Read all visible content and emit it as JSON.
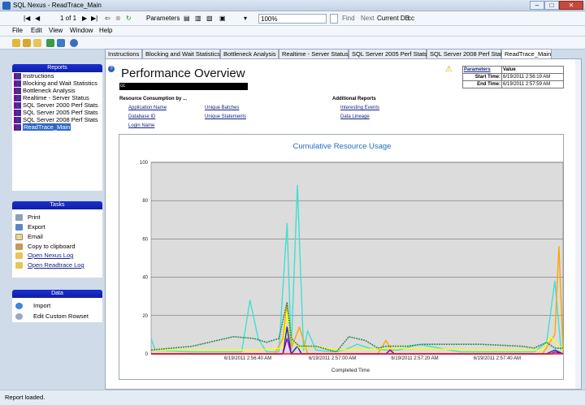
{
  "window": {
    "title": "SQL Nexus - ReadTrace_Main",
    "min": "–",
    "max": "□",
    "close": "✕"
  },
  "toolbar": {
    "page_info": "1 of 1",
    "parameters_label": "Parameters",
    "zoom": "100%",
    "find_label": "Find",
    "next_label": "Next",
    "current_db_label": "Current DB",
    "current_db_value": "cc"
  },
  "menu": [
    "File",
    "Edit",
    "View",
    "Window",
    "Help"
  ],
  "reports_panel": {
    "header": "Reports",
    "items": [
      "Instructions",
      "Blocking and Wait Statistics",
      "Bottleneck Analysis",
      "Realtime - Server Status",
      "SQL Server 2000 Perf Stats",
      "SQL Server 2005 Perf Stats",
      "SQL Server 2008 Perf Stats",
      "ReadTrace_Main"
    ],
    "selected": 7
  },
  "tasks_panel": {
    "header": "Tasks",
    "items": [
      "Print",
      "Export",
      "Email",
      "Copy to clipboard",
      "Open Nexus Log",
      "Open Readtrace Log"
    ]
  },
  "data_panel": {
    "header": "Data",
    "items": [
      "Import",
      "Edit Custom Rowset"
    ]
  },
  "tabs": [
    "Instructions",
    "Blocking and Wait Statistics",
    "Bottleneck Analysis",
    "Realtime - Server Status",
    "SQL Server 2005 Perf Stats",
    "SQL Server 2008 Perf Stats",
    "ReadTrace_Main"
  ],
  "active_tab": 6,
  "report": {
    "title": "Performance Overview",
    "server": "cc",
    "resource_heading": "Resource Consumption by ...",
    "resource_links_col1": [
      "Application Name",
      "Database ID",
      "Login Name"
    ],
    "resource_links_col2": [
      "Unique Batches",
      "Unique Statements"
    ],
    "additional_heading": "Additional Reports",
    "additional_links": [
      "Interesting Events",
      "Data Lineage"
    ],
    "params_table": {
      "headers": [
        "Parameters",
        "Value"
      ],
      "rows": [
        [
          "Start Time:",
          "6/19/2011 2:56:19 AM"
        ],
        [
          "End Time:",
          "6/19/2011 2:57:59 AM"
        ]
      ]
    }
  },
  "chart_data": {
    "type": "line",
    "title": "Cumulative Resource Usage",
    "xlabel": "Completed Time",
    "ylabel": "",
    "ylim": [
      0,
      100
    ],
    "yticks": [
      0,
      20,
      40,
      60,
      80,
      100
    ],
    "xlim": [
      0,
      100
    ],
    "xtick_labels": [
      {
        "x": 23.5,
        "label": "6/19/2011 2:56:40 AM"
      },
      {
        "x": 44,
        "label": "6/19/2011 2:57:00 AM"
      },
      {
        "x": 64,
        "label": "6/19/2011 2:57:20 AM"
      },
      {
        "x": 84,
        "label": "6/19/2011 2:57:40 AM"
      }
    ],
    "plot_background": "#dcdcdc",
    "grid": true,
    "series": [
      {
        "color": "#40e0d0",
        "points": [
          [
            0,
            8
          ],
          [
            1,
            2
          ],
          [
            10,
            1
          ],
          [
            22,
            1
          ],
          [
            24,
            28
          ],
          [
            26,
            8
          ],
          [
            28,
            1
          ],
          [
            31,
            1
          ],
          [
            33,
            68
          ],
          [
            34,
            2
          ],
          [
            35.5,
            88
          ],
          [
            37,
            2
          ],
          [
            38,
            12
          ],
          [
            40,
            2
          ],
          [
            44,
            1
          ],
          [
            47,
            2
          ],
          [
            50,
            5
          ],
          [
            53,
            3
          ],
          [
            57,
            2
          ],
          [
            60,
            2
          ],
          [
            65,
            5
          ],
          [
            75,
            1
          ],
          [
            93,
            1
          ],
          [
            96,
            6
          ],
          [
            98,
            38
          ],
          [
            99.5,
            2
          ]
        ]
      },
      {
        "color": "#ffa500",
        "points": [
          [
            0,
            0
          ],
          [
            30,
            0
          ],
          [
            32,
            8
          ],
          [
            33,
            26
          ],
          [
            34,
            3
          ],
          [
            36,
            14
          ],
          [
            38,
            0
          ],
          [
            55,
            0
          ],
          [
            57,
            7
          ],
          [
            59,
            0
          ],
          [
            95,
            0
          ],
          [
            98,
            10
          ],
          [
            99,
            56
          ],
          [
            100,
            2
          ]
        ]
      },
      {
        "color": "#1e2ea0",
        "points": [
          [
            0,
            0
          ],
          [
            32,
            0
          ],
          [
            33,
            14
          ],
          [
            34,
            0
          ],
          [
            35.5,
            4
          ],
          [
            36.5,
            0
          ],
          [
            96,
            0
          ],
          [
            98,
            2
          ],
          [
            100,
            0
          ]
        ]
      },
      {
        "color": "#9400d3",
        "points": [
          [
            0,
            0
          ],
          [
            32,
            0
          ],
          [
            33,
            8
          ],
          [
            34,
            0
          ],
          [
            57,
            0
          ],
          [
            58,
            2
          ],
          [
            59,
            0
          ],
          [
            97,
            0
          ],
          [
            98,
            1
          ],
          [
            100,
            0
          ]
        ]
      },
      {
        "color": "#ffff00",
        "points": [
          [
            0,
            2
          ],
          [
            15,
            2
          ],
          [
            25,
            2
          ],
          [
            32,
            3
          ],
          [
            33,
            22
          ],
          [
            34,
            8
          ],
          [
            36,
            3
          ],
          [
            40,
            4
          ],
          [
            45,
            2
          ],
          [
            60,
            3
          ],
          [
            80,
            2
          ],
          [
            95,
            2
          ],
          [
            97,
            9
          ],
          [
            100,
            2
          ]
        ]
      },
      {
        "color": "#2e8b57",
        "points": [
          [
            0,
            2
          ],
          [
            10,
            4
          ],
          [
            20,
            9
          ],
          [
            25,
            8
          ],
          [
            28,
            6
          ],
          [
            31,
            8
          ],
          [
            33,
            27
          ],
          [
            34,
            8
          ],
          [
            36,
            4
          ],
          [
            40,
            4
          ],
          [
            45,
            1
          ],
          [
            48,
            9
          ],
          [
            52,
            7
          ],
          [
            55,
            3
          ],
          [
            57,
            4
          ],
          [
            62,
            4
          ],
          [
            66,
            5
          ],
          [
            80,
            5
          ],
          [
            90,
            4
          ],
          [
            93,
            3
          ],
          [
            96,
            6
          ],
          [
            98,
            3
          ],
          [
            100,
            3
          ]
        ]
      },
      {
        "color": "#ee1c1c",
        "points": [
          [
            0,
            0
          ],
          [
            100,
            0
          ]
        ]
      }
    ]
  }
}
